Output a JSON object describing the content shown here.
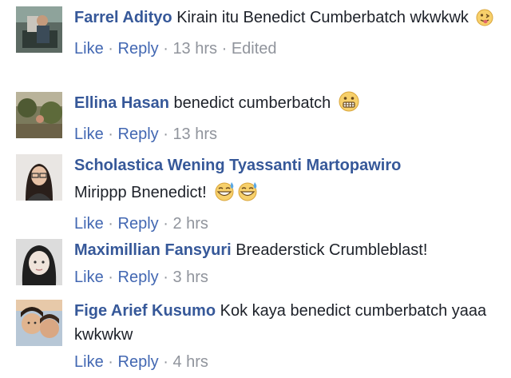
{
  "comments": [
    {
      "author": "Farrel Adityo",
      "text": "Kirain itu Benedict Cumberbatch wkwkwk",
      "emoji": "tongue-out-icon",
      "like": "Like",
      "sep1": "·",
      "reply": "Reply",
      "sep2": "·",
      "time": "13 hrs",
      "sep3": "·",
      "edited": "Edited"
    },
    {
      "author": "Ellina Hasan",
      "text": "benedict cumberbatch",
      "emoji": "grimacing-icon",
      "like": "Like",
      "sep1": "·",
      "reply": "Reply",
      "sep2": "·",
      "time": "13 hrs"
    },
    {
      "author": "Scholastica Wening Tyassanti Martopawiro",
      "text": "Mirippp Bnenedict!",
      "emoji": "sweat-smile-icon",
      "like": "Like",
      "sep1": "·",
      "reply": "Reply",
      "sep2": "·",
      "time": "2 hrs"
    },
    {
      "author": "Maximillian Fansyuri",
      "text": "Breaderstick Crumbleblast!",
      "like": "Like",
      "sep1": "·",
      "reply": "Reply",
      "sep2": "·",
      "time": "3 hrs"
    },
    {
      "author": "Fige Arief Kusumo",
      "text": "Kok kaya benedict cumberbatch yaaa kwkwkw",
      "like": "Like",
      "sep1": "·",
      "reply": "Reply",
      "sep2": "·",
      "time": "4 hrs"
    }
  ],
  "colors": {
    "author": "#365899",
    "link": "#4267b2",
    "meta": "#90949c",
    "text": "#1d2129"
  }
}
